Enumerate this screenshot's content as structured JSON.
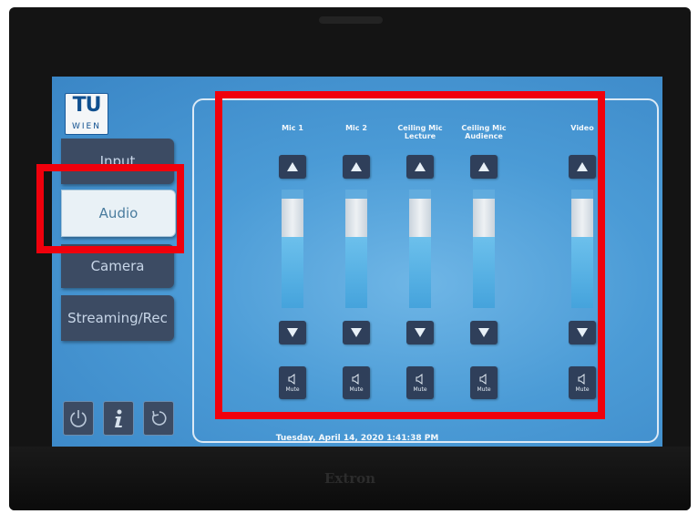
{
  "logo": {
    "line1": "TU",
    "line2": "WIEN"
  },
  "nav": {
    "items": [
      {
        "label": "Input"
      },
      {
        "label": "Audio"
      },
      {
        "label": "Camera"
      },
      {
        "label": "Streaming/Rec"
      }
    ],
    "active": "Audio"
  },
  "footer_icons": [
    "power-icon",
    "info-icon",
    "undo-icon"
  ],
  "channels": [
    {
      "label": "Mic 1",
      "level": 0.6,
      "mute_label": "Mute"
    },
    {
      "label": "Mic 2",
      "level": 0.6,
      "mute_label": "Mute"
    },
    {
      "label": "Ceiling Mic Lecture",
      "level": 0.6,
      "mute_label": "Mute"
    },
    {
      "label": "Ceiling Mic Audience",
      "level": 0.6,
      "mute_label": "Mute"
    },
    {
      "label": "Video",
      "level": 0.6,
      "mute_label": "Mute"
    }
  ],
  "status_bar": {
    "datetime": "Tuesday, April 14, 2020 1:41:38 PM"
  },
  "bezel": {
    "brand": "Extron"
  },
  "colors": {
    "highlight_boxes": "#f0000c",
    "button_dark": "#2f3f5a",
    "screen_blue": "#4b9bd6"
  }
}
